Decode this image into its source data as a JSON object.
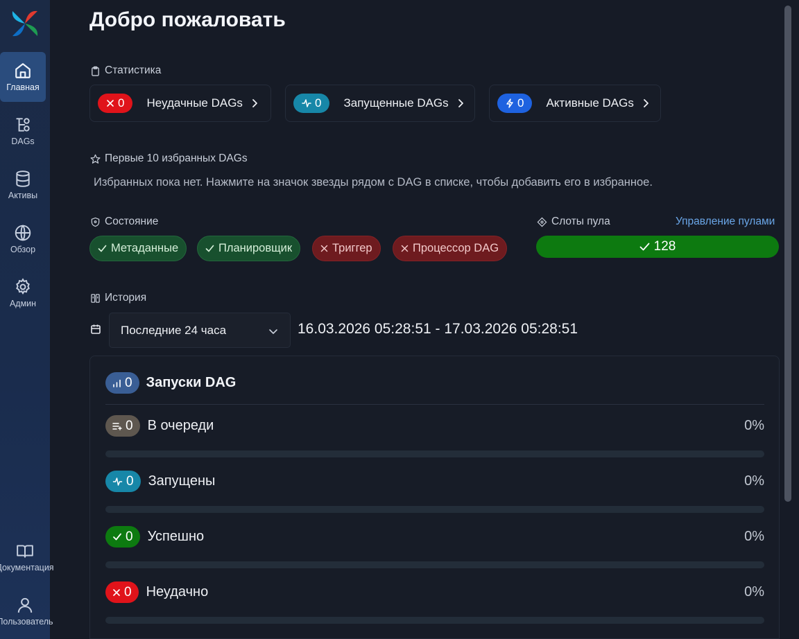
{
  "sidebar": {
    "items": [
      {
        "label": "Главная",
        "icon": "home-icon",
        "active": true
      },
      {
        "label": "DAGs",
        "icon": "dag-icon"
      },
      {
        "label": "Активы",
        "icon": "database-icon"
      },
      {
        "label": "Обзор",
        "icon": "globe-icon"
      },
      {
        "label": "Админ",
        "icon": "gear-icon"
      }
    ],
    "bottom_items": [
      {
        "label": "Документация",
        "icon": "book-icon"
      },
      {
        "label": "Пользователь",
        "icon": "user-icon"
      }
    ]
  },
  "page": {
    "title": "Добро пожаловать"
  },
  "stats": {
    "label": "Статистика",
    "cards": [
      {
        "count": "0",
        "label": "Неудачные DAGs",
        "color": "#e0131a",
        "icon": "x-icon"
      },
      {
        "count": "0",
        "label": "Запущенные DAGs",
        "color": "#1787a8",
        "icon": "activity-icon"
      },
      {
        "count": "0",
        "label": "Активные DAGs",
        "color": "#1e62e0",
        "icon": "bolt-icon"
      }
    ]
  },
  "favorites": {
    "label": "Первые 10 избранных DAGs",
    "empty_text": "Избранных пока нет. Нажмите на значок звезды рядом с DAG в списке, чтобы добавить его в избранное."
  },
  "health": {
    "label": "Состояние",
    "badges": [
      {
        "label": "Метаданные",
        "status": "ok"
      },
      {
        "label": "Планировщик",
        "status": "ok"
      },
      {
        "label": "Триггер",
        "status": "error"
      },
      {
        "label": "Процессор DAG",
        "status": "error"
      }
    ]
  },
  "pools": {
    "label": "Слоты пула",
    "manage_link": "Управление пулами",
    "open_slots": "128",
    "bar_color": "#0d7a10"
  },
  "history": {
    "label": "История",
    "range_option": "Последние 24 часа",
    "range_text": "16.03.2026 05:28:51 - 17.03.2026 05:28:51",
    "dag_runs": {
      "count": "0",
      "title": "Запуски DAG",
      "color": "#3a5e95",
      "rows": [
        {
          "name": "В очереди",
          "count": "0",
          "percent": "0%",
          "progress": 0,
          "color": "#5e574f",
          "icon": "queue-icon"
        },
        {
          "name": "Запущены",
          "count": "0",
          "percent": "0%",
          "progress": 0,
          "color": "#1787a8",
          "icon": "activity-icon"
        },
        {
          "name": "Успешно",
          "count": "0",
          "percent": "0%",
          "progress": 0,
          "color": "#0d7a10",
          "icon": "check-icon"
        },
        {
          "name": "Неудачно",
          "count": "0",
          "percent": "0%",
          "progress": 0,
          "color": "#e0131a",
          "icon": "x-icon"
        }
      ]
    }
  }
}
